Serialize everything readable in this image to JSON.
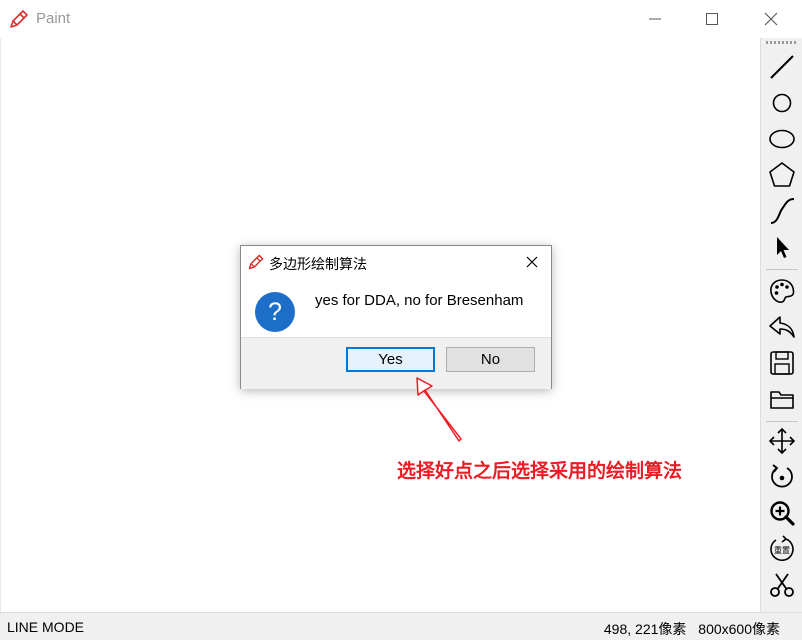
{
  "window": {
    "title": "Paint",
    "minimize_icon": "minimize-icon",
    "maximize_icon": "maximize-icon",
    "close_icon": "close-icon"
  },
  "toolbar": {
    "tools": [
      {
        "name": "line-tool",
        "icon": "line-icon"
      },
      {
        "name": "circle-tool",
        "icon": "circle-icon"
      },
      {
        "name": "ellipse-tool",
        "icon": "ellipse-icon"
      },
      {
        "name": "polygon-tool",
        "icon": "pentagon-icon"
      },
      {
        "name": "curve-tool",
        "icon": "curve-icon"
      },
      {
        "name": "select-tool",
        "icon": "cursor-arrow-icon"
      },
      {
        "name": "color-tool",
        "icon": "palette-icon"
      },
      {
        "name": "undo-tool",
        "icon": "undo-arrow-icon"
      },
      {
        "name": "save-tool",
        "icon": "save-disk-icon"
      },
      {
        "name": "open-tool",
        "icon": "folder-icon"
      },
      {
        "name": "move-tool",
        "icon": "move-arrows-icon"
      },
      {
        "name": "rotate-tool",
        "icon": "rotate-icon"
      },
      {
        "name": "zoom-tool",
        "icon": "zoom-in-icon"
      },
      {
        "name": "reset-tool",
        "icon": "reset-icon",
        "label": "重置"
      },
      {
        "name": "clip-tool",
        "icon": "scissors-icon"
      }
    ]
  },
  "dialog": {
    "title": "多边形绘制算法",
    "message": "yes for DDA, no for Bresenham",
    "question_icon": "question-icon",
    "question_glyph": "?",
    "yes_label": "Yes",
    "no_label": "No"
  },
  "annotation": {
    "text": "选择好点之后选择采用的绘制算法",
    "color": "#ec1c24"
  },
  "status": {
    "mode": "LINE MODE",
    "coords": "498, 221像素",
    "canvas_size": "800x600像素"
  },
  "colors": {
    "accent": "#0078d7",
    "question_icon_bg": "#1d6ec9",
    "annotation": "#ec1c24"
  }
}
